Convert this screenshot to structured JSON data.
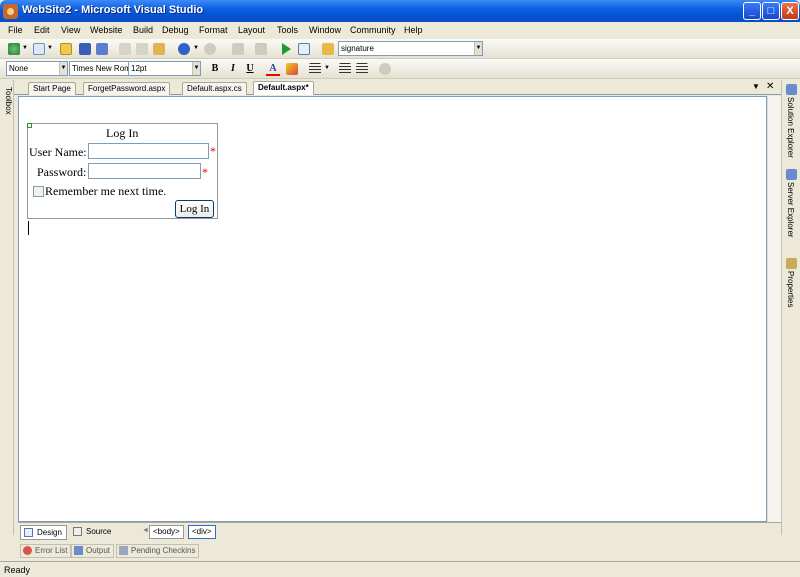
{
  "window": {
    "title": "WebSite2 - Microsoft Visual Studio",
    "controls": {
      "minimize": "_",
      "maximize": "□",
      "close": "X"
    }
  },
  "menu": [
    "File",
    "Edit",
    "View",
    "Website",
    "Build",
    "Debug",
    "Format",
    "Layout",
    "Tools",
    "Window",
    "Community",
    "Help"
  ],
  "toolbar": {
    "solution_config": "signature",
    "block_format": "None",
    "font_name": "Times New Roman",
    "font_size": "12pt",
    "bold": "B",
    "italic": "I",
    "underline": "U",
    "fore_color": "A"
  },
  "tabs": [
    "Start Page",
    "ForgetPassword.aspx",
    "Default.aspx.cs",
    "Default.aspx*"
  ],
  "active_tab": "Default.aspx*",
  "tab_controls": {
    "dropdown": "▼",
    "close": "✕"
  },
  "side_panels": {
    "toolbox": "Toolbox",
    "solution_explorer": "Solution Explorer",
    "server_explorer": "Server Explorer",
    "properties": "Properties"
  },
  "login": {
    "title": "Log In",
    "username_label": "User Name:",
    "username_value": "",
    "password_label": "Password:",
    "password_value": "",
    "required_marker": "*",
    "remember_label": "Remember me next time.",
    "remember_checked": false,
    "login_button": "Log In"
  },
  "view_bar": {
    "design": "Design",
    "source": "Source",
    "tags": [
      "<body>",
      "<div>"
    ]
  },
  "panel_tabs": [
    "Error List",
    "Output",
    "Pending Checkins"
  ],
  "status": "Ready"
}
